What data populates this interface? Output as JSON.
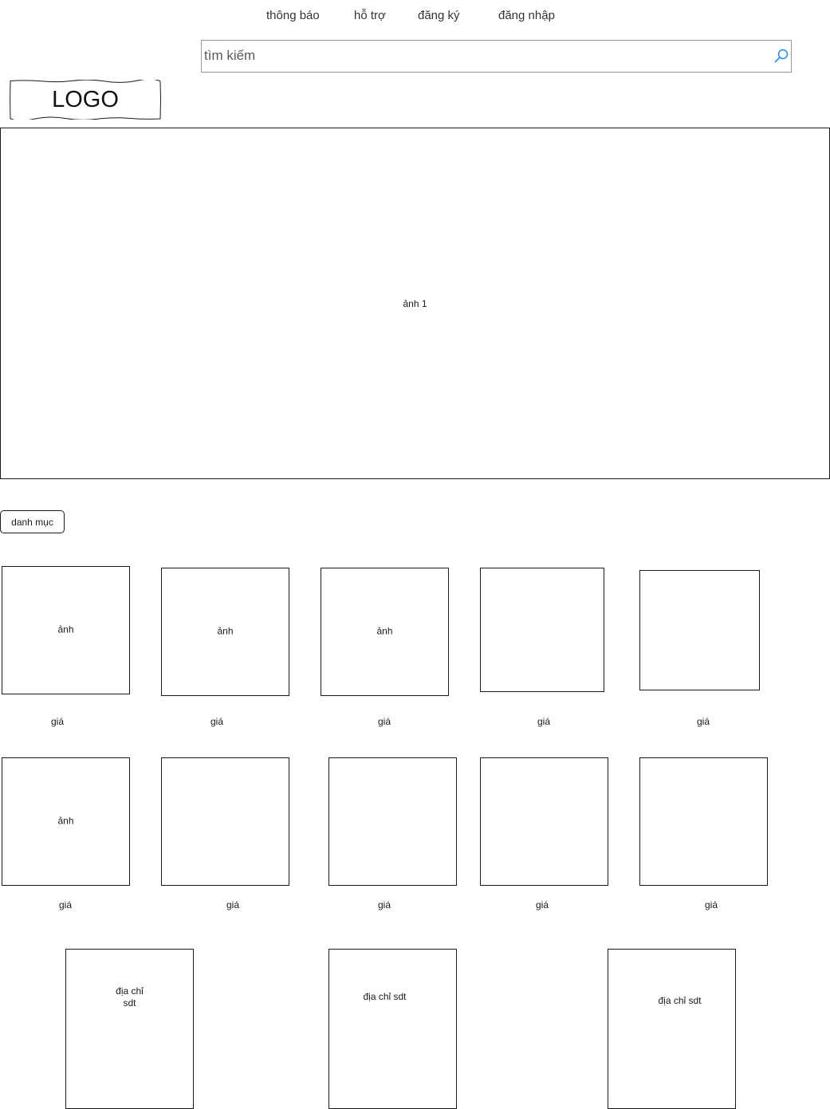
{
  "nav": {
    "notifications": "thông báo",
    "support": "hỗ trợ",
    "register": "đăng ký",
    "login": "đăng nhập"
  },
  "search": {
    "placeholder": "tìm kiếm",
    "icon": "search-icon",
    "icon_color": "#1e88e5"
  },
  "logo": {
    "text": "LOGO"
  },
  "banner": {
    "label": "ảnh 1"
  },
  "category": {
    "label": "danh mục"
  },
  "products": {
    "row1": [
      {
        "image_label": "ảnh",
        "price_label": "giá"
      },
      {
        "image_label": "ảnh",
        "price_label": "giá"
      },
      {
        "image_label": "ảnh",
        "price_label": "giá"
      },
      {
        "image_label": "",
        "price_label": "giá"
      },
      {
        "image_label": "",
        "price_label": "giá"
      }
    ],
    "row2": [
      {
        "image_label": "ảnh",
        "price_label": "giá"
      },
      {
        "image_label": "",
        "price_label": "giá"
      },
      {
        "image_label": "",
        "price_label": "giá"
      },
      {
        "image_label": "",
        "price_label": "giá"
      },
      {
        "image_label": "",
        "price_label": "giá"
      }
    ]
  },
  "stores": [
    {
      "line1": "địa chỉ",
      "line2": "sdt"
    },
    {
      "line1": "địa chỉ sdt",
      "line2": ""
    },
    {
      "line1": "địa chỉ sdt",
      "line2": ""
    }
  ]
}
